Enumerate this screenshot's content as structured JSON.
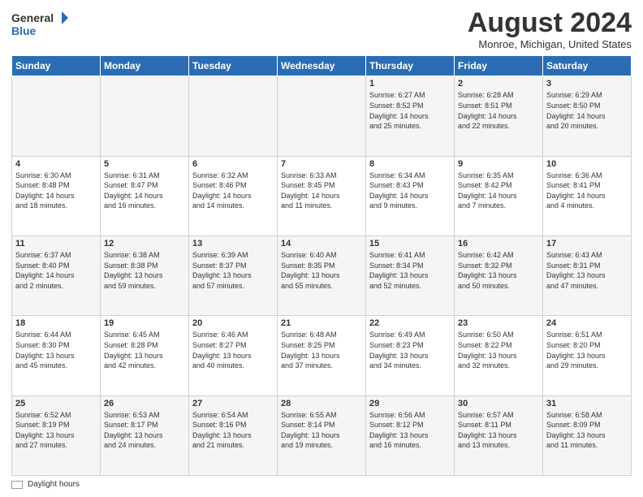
{
  "header": {
    "logo_general": "General",
    "logo_blue": "Blue",
    "month_title": "August 2024",
    "location": "Monroe, Michigan, United States"
  },
  "footer": {
    "daylight_label": "Daylight hours"
  },
  "calendar": {
    "headers": [
      "Sunday",
      "Monday",
      "Tuesday",
      "Wednesday",
      "Thursday",
      "Friday",
      "Saturday"
    ],
    "weeks": [
      [
        {
          "day": "",
          "detail": ""
        },
        {
          "day": "",
          "detail": ""
        },
        {
          "day": "",
          "detail": ""
        },
        {
          "day": "",
          "detail": ""
        },
        {
          "day": "1",
          "detail": "Sunrise: 6:27 AM\nSunset: 8:52 PM\nDaylight: 14 hours\nand 25 minutes."
        },
        {
          "day": "2",
          "detail": "Sunrise: 6:28 AM\nSunset: 8:51 PM\nDaylight: 14 hours\nand 22 minutes."
        },
        {
          "day": "3",
          "detail": "Sunrise: 6:29 AM\nSunset: 8:50 PM\nDaylight: 14 hours\nand 20 minutes."
        }
      ],
      [
        {
          "day": "4",
          "detail": "Sunrise: 6:30 AM\nSunset: 8:48 PM\nDaylight: 14 hours\nand 18 minutes."
        },
        {
          "day": "5",
          "detail": "Sunrise: 6:31 AM\nSunset: 8:47 PM\nDaylight: 14 hours\nand 16 minutes."
        },
        {
          "day": "6",
          "detail": "Sunrise: 6:32 AM\nSunset: 8:46 PM\nDaylight: 14 hours\nand 14 minutes."
        },
        {
          "day": "7",
          "detail": "Sunrise: 6:33 AM\nSunset: 8:45 PM\nDaylight: 14 hours\nand 11 minutes."
        },
        {
          "day": "8",
          "detail": "Sunrise: 6:34 AM\nSunset: 8:43 PM\nDaylight: 14 hours\nand 9 minutes."
        },
        {
          "day": "9",
          "detail": "Sunrise: 6:35 AM\nSunset: 8:42 PM\nDaylight: 14 hours\nand 7 minutes."
        },
        {
          "day": "10",
          "detail": "Sunrise: 6:36 AM\nSunset: 8:41 PM\nDaylight: 14 hours\nand 4 minutes."
        }
      ],
      [
        {
          "day": "11",
          "detail": "Sunrise: 6:37 AM\nSunset: 8:40 PM\nDaylight: 14 hours\nand 2 minutes."
        },
        {
          "day": "12",
          "detail": "Sunrise: 6:38 AM\nSunset: 8:38 PM\nDaylight: 13 hours\nand 59 minutes."
        },
        {
          "day": "13",
          "detail": "Sunrise: 6:39 AM\nSunset: 8:37 PM\nDaylight: 13 hours\nand 57 minutes."
        },
        {
          "day": "14",
          "detail": "Sunrise: 6:40 AM\nSunset: 8:35 PM\nDaylight: 13 hours\nand 55 minutes."
        },
        {
          "day": "15",
          "detail": "Sunrise: 6:41 AM\nSunset: 8:34 PM\nDaylight: 13 hours\nand 52 minutes."
        },
        {
          "day": "16",
          "detail": "Sunrise: 6:42 AM\nSunset: 8:32 PM\nDaylight: 13 hours\nand 50 minutes."
        },
        {
          "day": "17",
          "detail": "Sunrise: 6:43 AM\nSunset: 8:31 PM\nDaylight: 13 hours\nand 47 minutes."
        }
      ],
      [
        {
          "day": "18",
          "detail": "Sunrise: 6:44 AM\nSunset: 8:30 PM\nDaylight: 13 hours\nand 45 minutes."
        },
        {
          "day": "19",
          "detail": "Sunrise: 6:45 AM\nSunset: 8:28 PM\nDaylight: 13 hours\nand 42 minutes."
        },
        {
          "day": "20",
          "detail": "Sunrise: 6:46 AM\nSunset: 8:27 PM\nDaylight: 13 hours\nand 40 minutes."
        },
        {
          "day": "21",
          "detail": "Sunrise: 6:48 AM\nSunset: 8:25 PM\nDaylight: 13 hours\nand 37 minutes."
        },
        {
          "day": "22",
          "detail": "Sunrise: 6:49 AM\nSunset: 8:23 PM\nDaylight: 13 hours\nand 34 minutes."
        },
        {
          "day": "23",
          "detail": "Sunrise: 6:50 AM\nSunset: 8:22 PM\nDaylight: 13 hours\nand 32 minutes."
        },
        {
          "day": "24",
          "detail": "Sunrise: 6:51 AM\nSunset: 8:20 PM\nDaylight: 13 hours\nand 29 minutes."
        }
      ],
      [
        {
          "day": "25",
          "detail": "Sunrise: 6:52 AM\nSunset: 8:19 PM\nDaylight: 13 hours\nand 27 minutes."
        },
        {
          "day": "26",
          "detail": "Sunrise: 6:53 AM\nSunset: 8:17 PM\nDaylight: 13 hours\nand 24 minutes."
        },
        {
          "day": "27",
          "detail": "Sunrise: 6:54 AM\nSunset: 8:16 PM\nDaylight: 13 hours\nand 21 minutes."
        },
        {
          "day": "28",
          "detail": "Sunrise: 6:55 AM\nSunset: 8:14 PM\nDaylight: 13 hours\nand 19 minutes."
        },
        {
          "day": "29",
          "detail": "Sunrise: 6:56 AM\nSunset: 8:12 PM\nDaylight: 13 hours\nand 16 minutes."
        },
        {
          "day": "30",
          "detail": "Sunrise: 6:57 AM\nSunset: 8:11 PM\nDaylight: 13 hours\nand 13 minutes."
        },
        {
          "day": "31",
          "detail": "Sunrise: 6:58 AM\nSunset: 8:09 PM\nDaylight: 13 hours\nand 11 minutes."
        }
      ]
    ]
  }
}
